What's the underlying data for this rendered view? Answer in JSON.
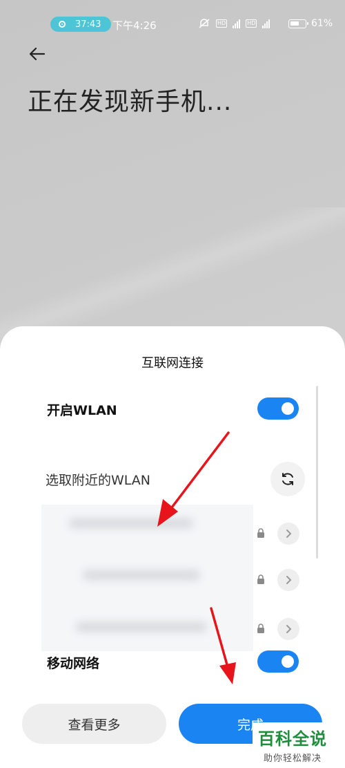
{
  "status_bar": {
    "record_time": "37:43",
    "clock": "下午4:26",
    "battery": "61%"
  },
  "header": {
    "title": "正在发现新手机..."
  },
  "sheet": {
    "title": "互联网连接",
    "wlan_toggle": {
      "label": "开启WLAN",
      "on": true
    },
    "nearby_label": "选取附近的WLAN",
    "networks": [
      {
        "name": "",
        "secured": true
      },
      {
        "name": "",
        "secured": true
      },
      {
        "name": "",
        "secured": true
      }
    ],
    "mobile_toggle": {
      "label": "移动网络",
      "on": true
    },
    "buttons": {
      "more": "查看更多",
      "done": "完成"
    }
  },
  "watermark": {
    "main": "百科全说",
    "sub": "助你轻松解决"
  },
  "colors": {
    "accent": "#1a84f2",
    "annotation_arrow": "#e8141b",
    "record_pill": "#4cc6d6"
  }
}
